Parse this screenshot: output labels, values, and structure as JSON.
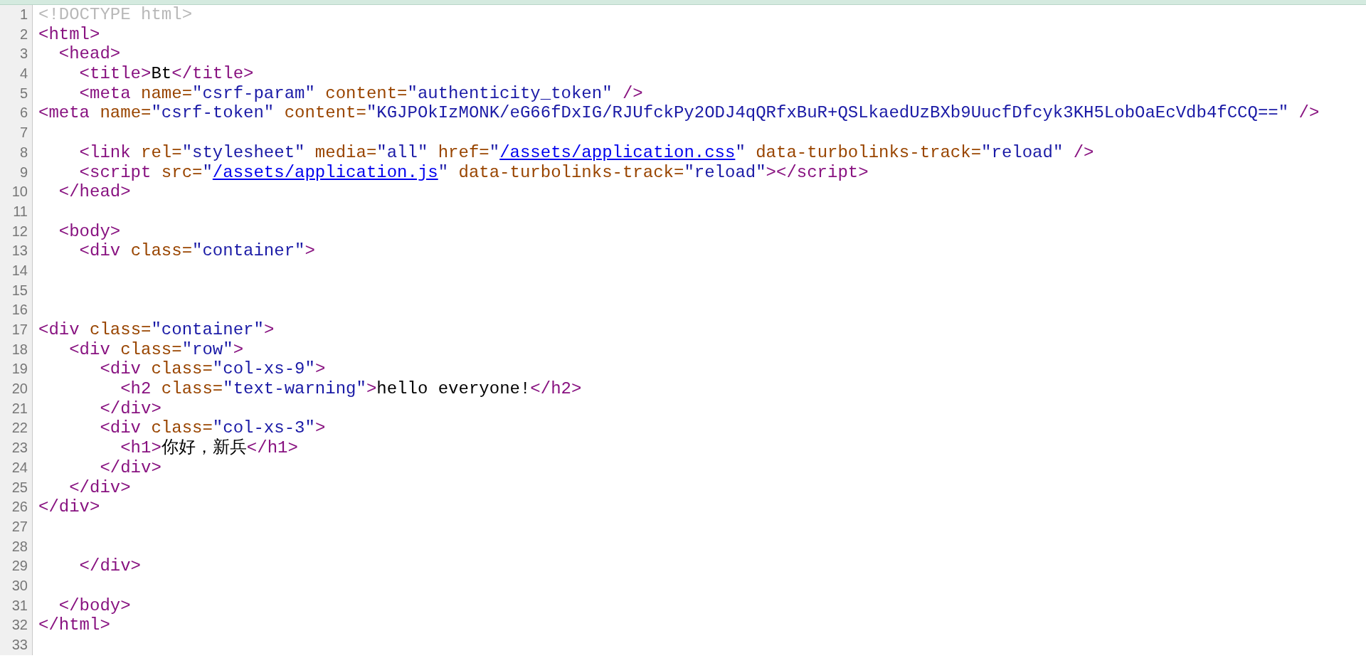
{
  "lines": [
    {
      "number": "1",
      "tokens": [
        {
          "kind": "doctype",
          "text": "<!DOCTYPE html>"
        }
      ]
    },
    {
      "number": "2",
      "tokens": [
        {
          "kind": "tag",
          "text": "<html>"
        }
      ]
    },
    {
      "number": "3",
      "tokens": [
        {
          "kind": "tag",
          "text": "  <head>"
        }
      ]
    },
    {
      "number": "4",
      "tokens": [
        {
          "kind": "tag",
          "text": "    <title>"
        },
        {
          "kind": "text",
          "text": "Bt"
        },
        {
          "kind": "tag",
          "text": "</title>"
        }
      ]
    },
    {
      "number": "5",
      "tokens": [
        {
          "kind": "tag",
          "text": "    <meta "
        },
        {
          "kind": "attr",
          "text": "name="
        },
        {
          "kind": "value",
          "text": "\"csrf-param\""
        },
        {
          "kind": "attr",
          "text": " content="
        },
        {
          "kind": "value",
          "text": "\"authenticity_token\""
        },
        {
          "kind": "tag",
          "text": " />"
        }
      ]
    },
    {
      "number": "6",
      "tokens": [
        {
          "kind": "tag",
          "text": "<meta "
        },
        {
          "kind": "attr",
          "text": "name="
        },
        {
          "kind": "value",
          "text": "\"csrf-token\""
        },
        {
          "kind": "attr",
          "text": " content="
        },
        {
          "kind": "value",
          "text": "\"KGJPOkIzMONK/eG66fDxIG/RJUfckPy2ODJ4qQRfxBuR+QSLkaedUzBXb9UucfDfcyk3KH5LobOaEcVdb4fCCQ==\""
        },
        {
          "kind": "tag",
          "text": " />"
        }
      ]
    },
    {
      "number": "7"
    },
    {
      "number": "8",
      "tokens": [
        {
          "kind": "tag",
          "text": "    <link "
        },
        {
          "kind": "attr",
          "text": "rel="
        },
        {
          "kind": "value",
          "text": "\"stylesheet\""
        },
        {
          "kind": "attr",
          "text": " media="
        },
        {
          "kind": "value",
          "text": "\"all\""
        },
        {
          "kind": "attr",
          "text": " href="
        },
        {
          "kind": "value",
          "text": "\""
        },
        {
          "kind": "link",
          "text": "/assets/application.css"
        },
        {
          "kind": "value",
          "text": "\""
        },
        {
          "kind": "attr",
          "text": " data-turbolinks-track="
        },
        {
          "kind": "value",
          "text": "\"reload\""
        },
        {
          "kind": "tag",
          "text": " />"
        }
      ]
    },
    {
      "number": "9",
      "tokens": [
        {
          "kind": "tag",
          "text": "    <script "
        },
        {
          "kind": "attr",
          "text": "src="
        },
        {
          "kind": "value",
          "text": "\""
        },
        {
          "kind": "link",
          "text": "/assets/application.js"
        },
        {
          "kind": "value",
          "text": "\""
        },
        {
          "kind": "attr",
          "text": " data-turbolinks-track="
        },
        {
          "kind": "value",
          "text": "\"reload\""
        },
        {
          "kind": "tag",
          "text": "></script>"
        }
      ]
    },
    {
      "number": "10",
      "tokens": [
        {
          "kind": "tag",
          "text": "  </head>"
        }
      ]
    },
    {
      "number": "11"
    },
    {
      "number": "12",
      "tokens": [
        {
          "kind": "tag",
          "text": "  <body>"
        }
      ]
    },
    {
      "number": "13",
      "tokens": [
        {
          "kind": "tag",
          "text": "    <div "
        },
        {
          "kind": "attr",
          "text": "class="
        },
        {
          "kind": "value",
          "text": "\"container\""
        },
        {
          "kind": "tag",
          "text": ">"
        }
      ]
    },
    {
      "number": "14"
    },
    {
      "number": "15"
    },
    {
      "number": "16"
    },
    {
      "number": "17",
      "tokens": [
        {
          "kind": "tag",
          "text": "<div "
        },
        {
          "kind": "attr",
          "text": "class="
        },
        {
          "kind": "value",
          "text": "\"container\""
        },
        {
          "kind": "tag",
          "text": ">"
        }
      ]
    },
    {
      "number": "18",
      "tokens": [
        {
          "kind": "tag",
          "text": "   <div "
        },
        {
          "kind": "attr",
          "text": "class="
        },
        {
          "kind": "value",
          "text": "\"row\""
        },
        {
          "kind": "tag",
          "text": ">"
        }
      ]
    },
    {
      "number": "19",
      "tokens": [
        {
          "kind": "tag",
          "text": "      <div "
        },
        {
          "kind": "attr",
          "text": "class="
        },
        {
          "kind": "value",
          "text": "\"col-xs-9\""
        },
        {
          "kind": "tag",
          "text": ">"
        }
      ]
    },
    {
      "number": "20",
      "tokens": [
        {
          "kind": "tag",
          "text": "        <h2 "
        },
        {
          "kind": "attr",
          "text": "class="
        },
        {
          "kind": "value",
          "text": "\"text-warning\""
        },
        {
          "kind": "tag",
          "text": ">"
        },
        {
          "kind": "text",
          "text": "hello everyone!"
        },
        {
          "kind": "tag",
          "text": "</h2>"
        }
      ]
    },
    {
      "number": "21",
      "tokens": [
        {
          "kind": "tag",
          "text": "      </div>"
        }
      ]
    },
    {
      "number": "22",
      "tokens": [
        {
          "kind": "tag",
          "text": "      <div "
        },
        {
          "kind": "attr",
          "text": "class="
        },
        {
          "kind": "value",
          "text": "\"col-xs-3\""
        },
        {
          "kind": "tag",
          "text": ">"
        }
      ]
    },
    {
      "number": "23",
      "tokens": [
        {
          "kind": "tag",
          "text": "        <h1>"
        },
        {
          "kind": "text",
          "text": "你好，新兵"
        },
        {
          "kind": "tag",
          "text": "</h1>"
        }
      ]
    },
    {
      "number": "24",
      "tokens": [
        {
          "kind": "tag",
          "text": "      </div>"
        }
      ]
    },
    {
      "number": "25",
      "tokens": [
        {
          "kind": "tag",
          "text": "   </div>"
        }
      ]
    },
    {
      "number": "26",
      "tokens": [
        {
          "kind": "tag",
          "text": "</div>"
        }
      ]
    },
    {
      "number": "27"
    },
    {
      "number": "28"
    },
    {
      "number": "29",
      "tokens": [
        {
          "kind": "tag",
          "text": "    </div>"
        }
      ]
    },
    {
      "number": "30"
    },
    {
      "number": "31",
      "tokens": [
        {
          "kind": "tag",
          "text": "  </body>"
        }
      ]
    },
    {
      "number": "32",
      "tokens": [
        {
          "kind": "tag",
          "text": "</html>"
        }
      ]
    },
    {
      "number": "33"
    }
  ]
}
